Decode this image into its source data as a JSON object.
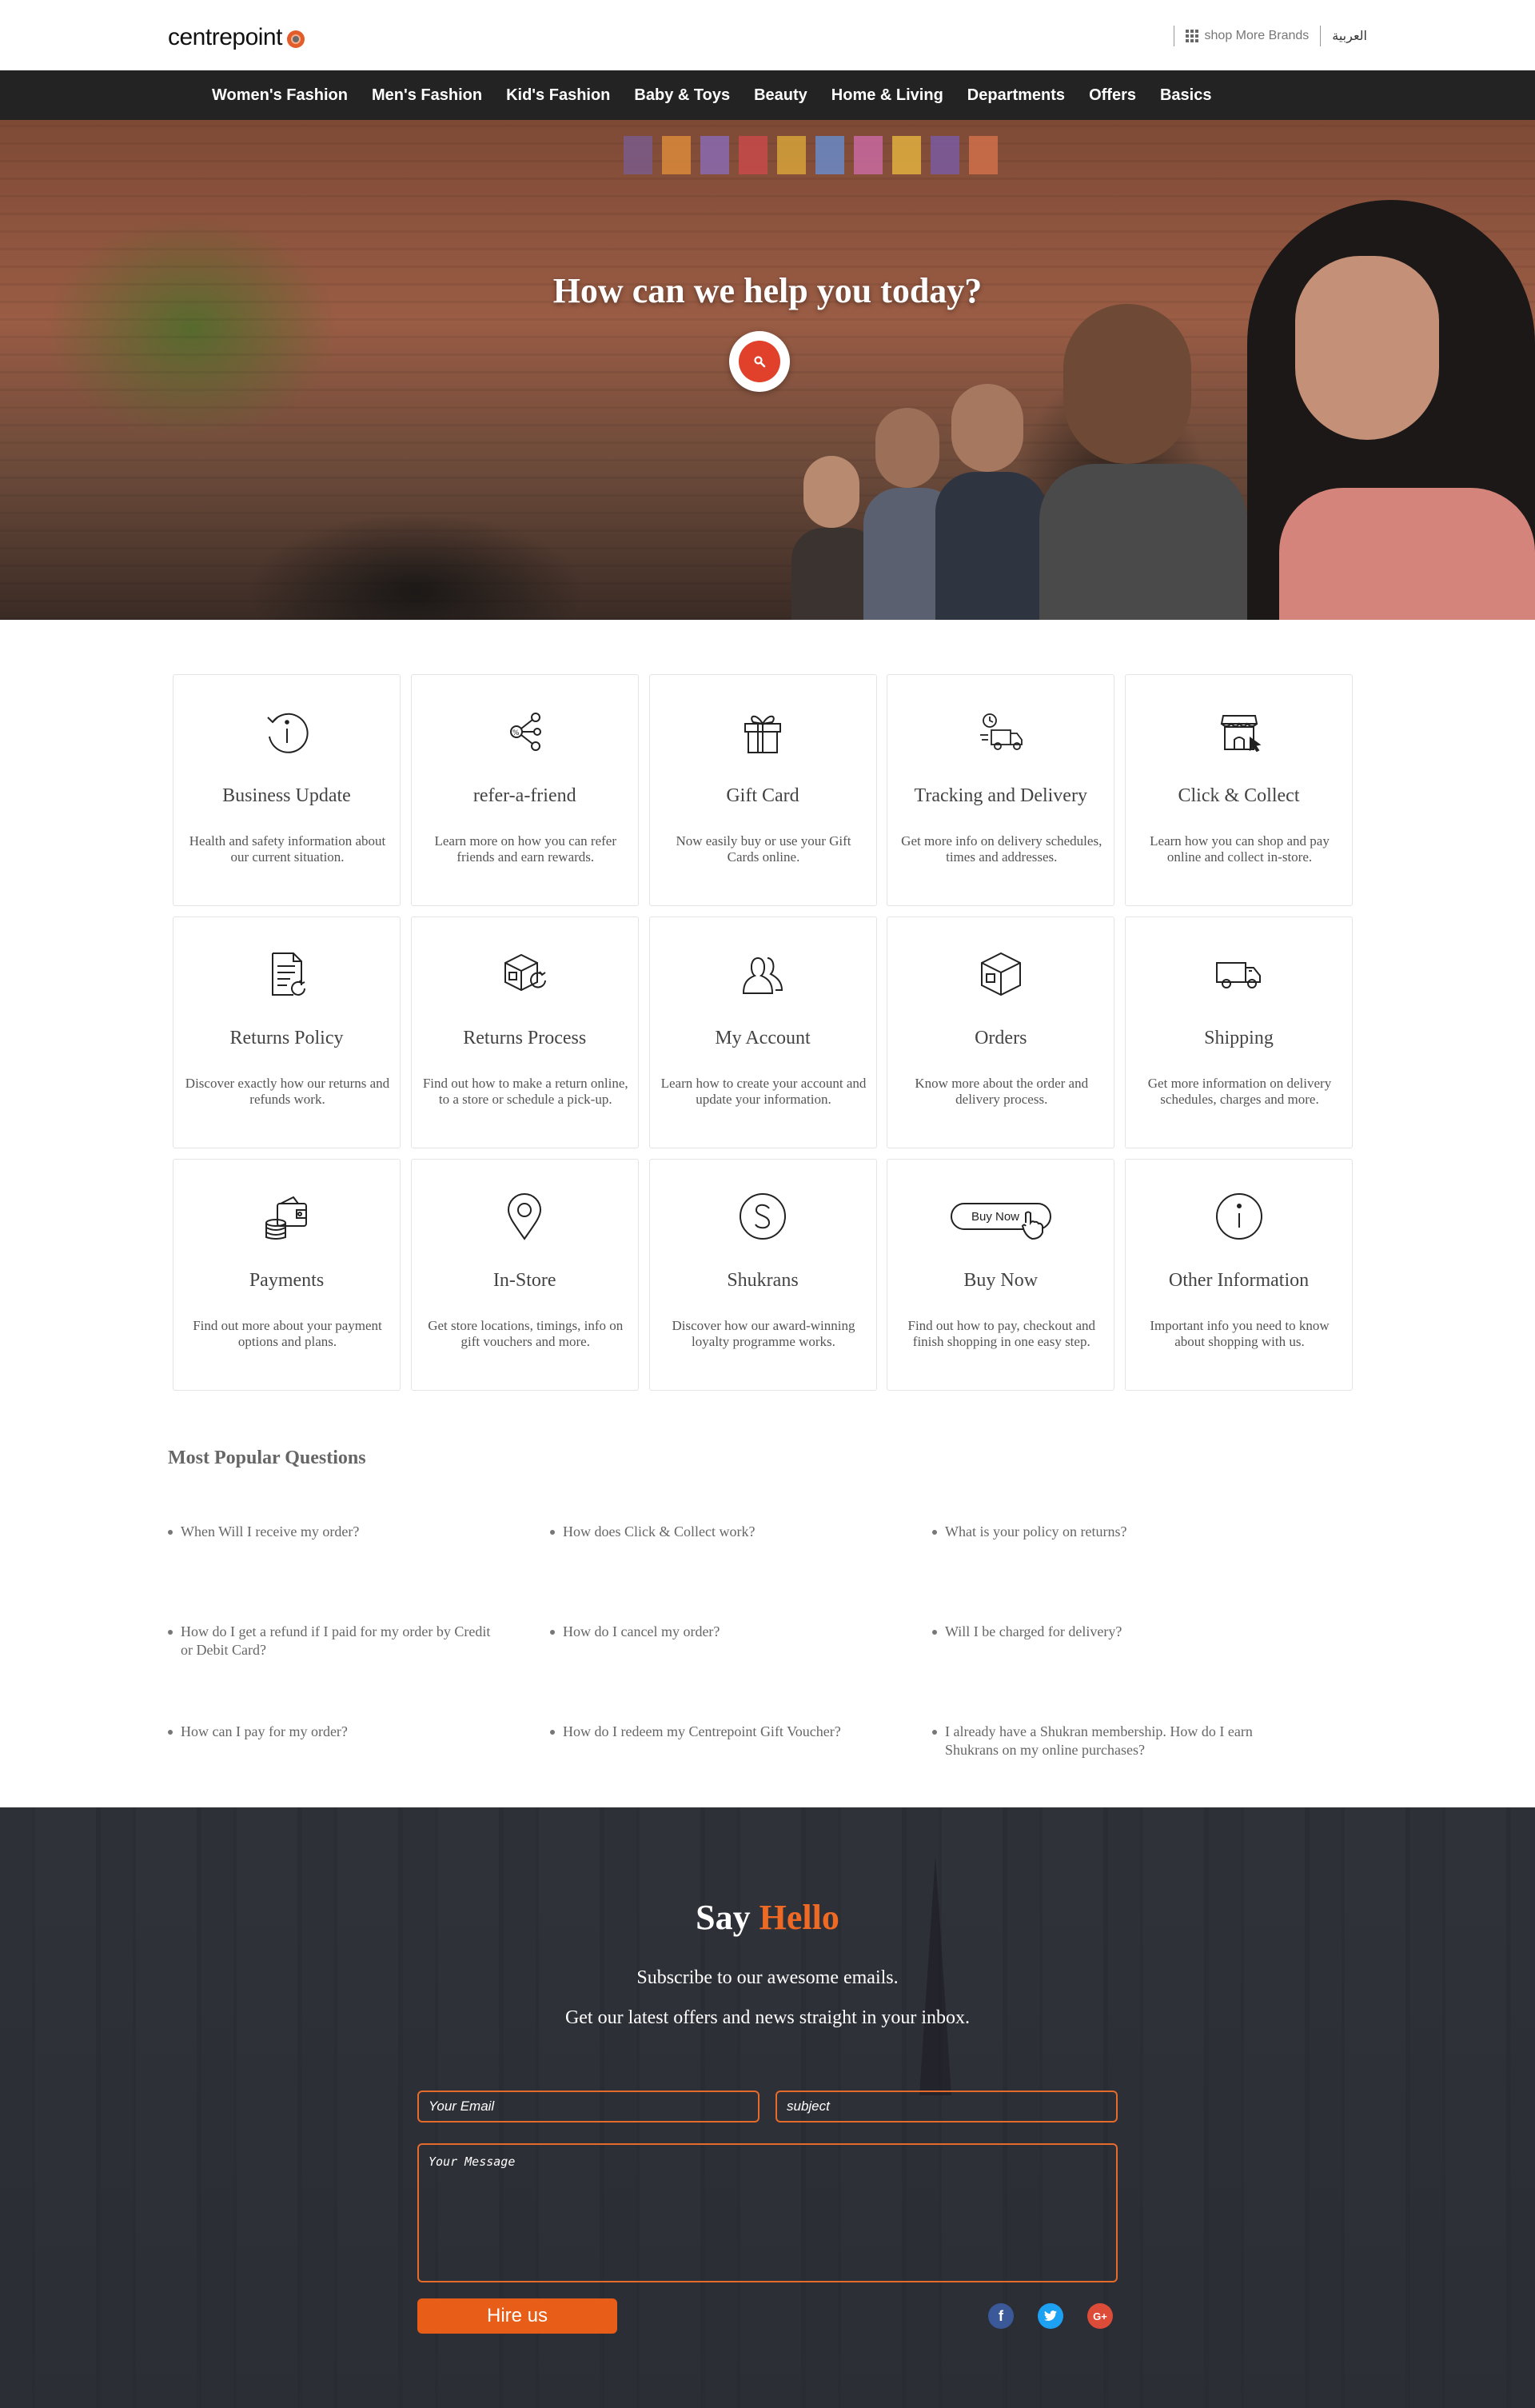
{
  "header": {
    "logo_text": "centrepoint",
    "shop_more_brands": "shop More Brands",
    "arabic_link": "العربية"
  },
  "nav": {
    "items": [
      "Women's Fashion",
      "Men's Fashion",
      "Kid's Fashion",
      "Baby & Toys",
      "Beauty",
      "Home & Living",
      "Departments",
      "Offers",
      "Basics"
    ]
  },
  "hero": {
    "title": "How can we help you today?"
  },
  "cards": [
    {
      "icon": "info-refresh-icon",
      "title": "Business Update",
      "desc": "Health and safety information about our current situation."
    },
    {
      "icon": "share-icon",
      "title": "refer-a-friend",
      "desc": "Learn more on how you can refer friends and earn rewards."
    },
    {
      "icon": "gift-icon",
      "title": "Gift Card",
      "desc": "Now easily buy or use your Gift Cards online."
    },
    {
      "icon": "delivery-truck-clock-icon",
      "title": "Tracking and Delivery",
      "desc": "Get more info on delivery schedules, times and addresses."
    },
    {
      "icon": "store-pointer-icon",
      "title": "Click & Collect",
      "desc": "Learn how you can shop and pay online and collect in-store."
    },
    {
      "icon": "document-return-icon",
      "title": "Returns Policy",
      "desc": "Discover exactly how our returns and refunds work."
    },
    {
      "icon": "box-return-icon",
      "title": "Returns Process",
      "desc": "Find out how to make a return online, to a store or schedule a pick-up."
    },
    {
      "icon": "user-account-icon",
      "title": "My Account",
      "desc": "Learn how to create your account and update your information."
    },
    {
      "icon": "box-icon",
      "title": "Orders",
      "desc": "Know more about the order and delivery process."
    },
    {
      "icon": "truck-icon",
      "title": "Shipping",
      "desc": "Get more information on delivery schedules, charges and more."
    },
    {
      "icon": "wallet-coins-icon",
      "title": "Payments",
      "desc": "Find out more about your payment options and plans."
    },
    {
      "icon": "location-pin-icon",
      "title": "In-Store",
      "desc": "Get store locations, timings, info on gift vouchers and more."
    },
    {
      "icon": "shukrans-s-icon",
      "title": "Shukrans",
      "desc": "Discover how our award-winning loyalty programme works."
    },
    {
      "icon": "buy-now-button-icon",
      "icon_text": "Buy Now",
      "title": "Buy Now",
      "desc": "Find out how to pay, checkout and finish shopping in one easy step."
    },
    {
      "icon": "info-icon",
      "title": "Other Information",
      "desc": "Important info you need to know about shopping with us."
    }
  ],
  "popular": {
    "title": "Most Popular Questions",
    "questions": [
      "When Will I receive my order?",
      "How does Click & Collect work?",
      "What is your policy on returns?",
      "How do I get a refund if I paid for my order by Credit or Debit Card?",
      "How do I cancel my order?",
      "Will I be charged for delivery?",
      "How can I pay for my order?",
      "How do I redeem my Centrepoint Gift Voucher?",
      "I already have a Shukran membership. How do I earn Shukrans on my online purchases?"
    ]
  },
  "contact": {
    "say": "Say",
    "hello": "Hello",
    "subtitle1": "Subscribe to our awesome emails.",
    "subtitle2": "Get our latest offers and news straight in your inbox.",
    "email_placeholder": "Your Email",
    "subject_placeholder": "subject",
    "message_placeholder": "Your Message",
    "button_label": "Hire us",
    "social": {
      "facebook": "f",
      "twitter": "t",
      "google_plus": "G+"
    }
  },
  "colors": {
    "accent": "#e85d18",
    "nav_bg": "#232323",
    "search_red": "#e1402b"
  }
}
